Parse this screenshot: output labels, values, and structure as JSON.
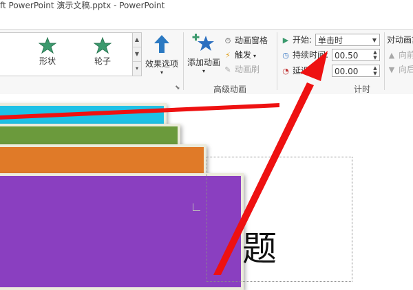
{
  "window": {
    "title": "ft PowerPoint 演示文稿.pptx - PowerPoint"
  },
  "ribbon": {
    "gallery": {
      "items": [
        {
          "label": "形状",
          "icon": "star-icon"
        },
        {
          "label": "轮子",
          "icon": "star-icon"
        }
      ]
    },
    "effect_options": {
      "label": "效果选项",
      "icon": "up-arrow-icon"
    },
    "add_animation": {
      "label": "添加动画",
      "icon": "star-plus-icon"
    },
    "advanced": {
      "animation_pane": "动画窗格",
      "trigger": "触发",
      "animation_painter": "动画刷",
      "group_label": "高级动画"
    },
    "timing": {
      "start_label": "开始:",
      "start_value": "单击时",
      "duration_label": "持续时间:",
      "duration_value": "00.50",
      "delay_label": "延迟",
      "delay_value": "00.00",
      "group_label": "计时"
    },
    "reorder": {
      "title": "对动画重",
      "move_earlier": "向前",
      "move_later": "向后"
    }
  },
  "slide": {
    "title_text": "题"
  },
  "colors": {
    "ribbon_bg": "#f7f7f7",
    "accent_green": "#3c9a6e",
    "arrow_red": "#ee1111",
    "layer_cyan": "#1ec1e6",
    "layer_green": "#6b9a3c",
    "layer_orange": "#e07a28",
    "layer_purple": "#8a3fc0",
    "layer_frame": "#ecebdc"
  }
}
